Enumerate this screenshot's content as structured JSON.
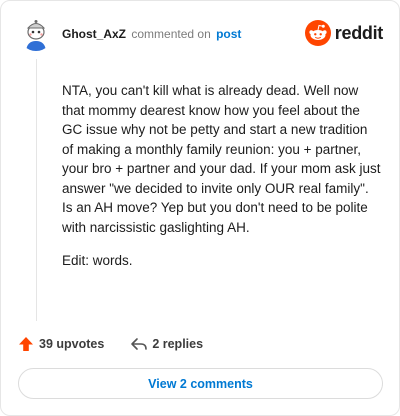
{
  "header": {
    "username": "Ghost_AxZ",
    "verb": "commented on",
    "post_link": "post",
    "brand": "reddit"
  },
  "comment": {
    "paragraphs": [
      "NTA, you can't kill what is already dead. Well now that mommy dearest know how you feel about the GC issue why not be petty and start a new tradition of making a monthly family reunion: you + partner, your bro + partner and your dad. If your mom ask just answer \"we decided to invite only OUR real family\". Is an AH move? Yep but you don't need to be polite with narcissistic gaslighting AH.",
      "Edit: words."
    ]
  },
  "actions": {
    "upvotes": "39 upvotes",
    "replies": "2 replies"
  },
  "view_button": "View 2 comments",
  "colors": {
    "reddit_orange": "#ff4500",
    "link_blue": "#0079d3"
  }
}
